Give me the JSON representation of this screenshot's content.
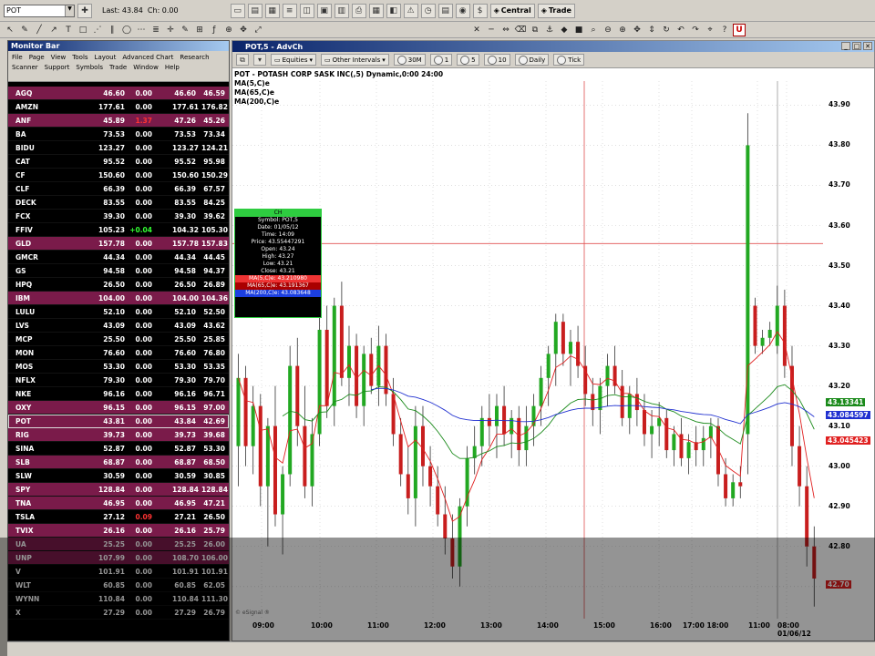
{
  "toolbar": {
    "symbol": "POT",
    "last_label": "Last: 43.84",
    "chg_label": "Ch: 0.00",
    "central_label": "Central",
    "trade_label": "Trade",
    "u_label": "U"
  },
  "monitor": {
    "title": "Monitor Bar",
    "menu": [
      "File",
      "Page",
      "View",
      "Tools",
      "Layout",
      "Advanced Chart",
      "Research",
      "Scanner",
      "Support",
      "Symbols",
      "Trade",
      "Window",
      "Help"
    ],
    "rows": [
      {
        "sym": "AGQ",
        "v1": "46.60",
        "v2": "0.00",
        "v3": "46.60",
        "v4": "46.59",
        "hl": true
      },
      {
        "sym": "AMZN",
        "v1": "177.61",
        "v2": "0.00",
        "v3": "177.61",
        "v4": "176.82",
        "hl": false
      },
      {
        "sym": "ANF",
        "v1": "45.89",
        "v2": "1.37",
        "v3": "47.26",
        "v4": "45.26",
        "hl": true
      },
      {
        "sym": "BA",
        "v1": "73.53",
        "v2": "0.00",
        "v3": "73.53",
        "v4": "73.34",
        "hl": false
      },
      {
        "sym": "BIDU",
        "v1": "123.27",
        "v2": "0.00",
        "v3": "123.27",
        "v4": "124.21",
        "hl": false
      },
      {
        "sym": "CAT",
        "v1": "95.52",
        "v2": "0.00",
        "v3": "95.52",
        "v4": "95.98",
        "hl": false
      },
      {
        "sym": "CF",
        "v1": "150.60",
        "v2": "0.00",
        "v3": "150.60",
        "v4": "150.29",
        "hl": false
      },
      {
        "sym": "CLF",
        "v1": "66.39",
        "v2": "0.00",
        "v3": "66.39",
        "v4": "67.57",
        "hl": false
      },
      {
        "sym": "DECK",
        "v1": "83.55",
        "v2": "0.00",
        "v3": "83.55",
        "v4": "84.25",
        "hl": false
      },
      {
        "sym": "FCX",
        "v1": "39.30",
        "v2": "0.00",
        "v3": "39.30",
        "v4": "39.62",
        "hl": false
      },
      {
        "sym": "FFIV",
        "v1": "105.23",
        "v2": "+0.04",
        "v3": "104.32",
        "v4": "105.30",
        "hl": false
      },
      {
        "sym": "GLD",
        "v1": "157.78",
        "v2": "0.00",
        "v3": "157.78",
        "v4": "157.83",
        "hl": true
      },
      {
        "sym": "GMCR",
        "v1": "44.34",
        "v2": "0.00",
        "v3": "44.34",
        "v4": "44.45",
        "hl": false
      },
      {
        "sym": "GS",
        "v1": "94.58",
        "v2": "0.00",
        "v3": "94.58",
        "v4": "94.37",
        "hl": false
      },
      {
        "sym": "HPQ",
        "v1": "26.50",
        "v2": "0.00",
        "v3": "26.50",
        "v4": "26.89",
        "hl": false
      },
      {
        "sym": "IBM",
        "v1": "104.00",
        "v2": "0.00",
        "v3": "104.00",
        "v4": "104.36",
        "hl": true
      },
      {
        "sym": "LULU",
        "v1": "52.10",
        "v2": "0.00",
        "v3": "52.10",
        "v4": "52.50",
        "hl": false
      },
      {
        "sym": "LVS",
        "v1": "43.09",
        "v2": "0.00",
        "v3": "43.09",
        "v4": "43.62",
        "hl": false
      },
      {
        "sym": "MCP",
        "v1": "25.50",
        "v2": "0.00",
        "v3": "25.50",
        "v4": "25.85",
        "hl": false
      },
      {
        "sym": "MON",
        "v1": "76.60",
        "v2": "0.00",
        "v3": "76.60",
        "v4": "76.80",
        "hl": false
      },
      {
        "sym": "MOS",
        "v1": "53.30",
        "v2": "0.00",
        "v3": "53.30",
        "v4": "53.35",
        "hl": false
      },
      {
        "sym": "NFLX",
        "v1": "79.30",
        "v2": "0.00",
        "v3": "79.30",
        "v4": "79.70",
        "hl": false
      },
      {
        "sym": "NKE",
        "v1": "96.16",
        "v2": "0.00",
        "v3": "96.16",
        "v4": "96.71",
        "hl": false
      },
      {
        "sym": "OXY",
        "v1": "96.15",
        "v2": "0.00",
        "v3": "96.15",
        "v4": "97.00",
        "hl": true
      },
      {
        "sym": "POT",
        "v1": "43.81",
        "v2": "0.00",
        "v3": "43.84",
        "v4": "42.69",
        "hl": true,
        "sel": true
      },
      {
        "sym": "RIG",
        "v1": "39.73",
        "v2": "0.00",
        "v3": "39.73",
        "v4": "39.68",
        "hl": true
      },
      {
        "sym": "SINA",
        "v1": "52.87",
        "v2": "0.00",
        "v3": "52.87",
        "v4": "53.30",
        "hl": false
      },
      {
        "sym": "SLB",
        "v1": "68.87",
        "v2": "0.00",
        "v3": "68.87",
        "v4": "68.50",
        "hl": true
      },
      {
        "sym": "SLW",
        "v1": "30.59",
        "v2": "0.00",
        "v3": "30.59",
        "v4": "30.85",
        "hl": false
      },
      {
        "sym": "SPY",
        "v1": "128.84",
        "v2": "0.00",
        "v3": "128.84",
        "v4": "128.84",
        "hl": true
      },
      {
        "sym": "TNA",
        "v1": "46.95",
        "v2": "0.00",
        "v3": "46.95",
        "v4": "47.21",
        "hl": true
      },
      {
        "sym": "TSLA",
        "v1": "27.12",
        "v2": "0.09",
        "v3": "27.21",
        "v4": "26.50",
        "hl": false
      },
      {
        "sym": "TVIX",
        "v1": "26.16",
        "v2": "0.00",
        "v3": "26.16",
        "v4": "25.79",
        "hl": true
      },
      {
        "sym": "UA",
        "v1": "25.25",
        "v2": "0.00",
        "v3": "25.25",
        "v4": "26.00",
        "hl": true
      },
      {
        "sym": "UNP",
        "v1": "107.99",
        "v2": "0.00",
        "v3": "108.70",
        "v4": "106.00",
        "hl": true
      },
      {
        "sym": "V",
        "v1": "101.91",
        "v2": "0.00",
        "v3": "101.91",
        "v4": "101.91",
        "hl": false
      },
      {
        "sym": "WLT",
        "v1": "60.85",
        "v2": "0.00",
        "v3": "60.85",
        "v4": "62.05",
        "hl": false
      },
      {
        "sym": "WYNN",
        "v1": "110.84",
        "v2": "0.00",
        "v3": "110.84",
        "v4": "111.30",
        "hl": false
      },
      {
        "sym": "X",
        "v1": "27.29",
        "v2": "0.00",
        "v3": "27.29",
        "v4": "26.79",
        "hl": false
      }
    ]
  },
  "chart_window": {
    "title": "POT,5 - AdvCh",
    "toolbar": {
      "equities": "Equities",
      "intervals": "Other Intervals",
      "i1": "30M",
      "i2": "1",
      "i3": "5",
      "i4": "10",
      "i5": "Daily",
      "i6": "Tick"
    },
    "info_line": "POT - POTASH CORP SASK INC(,5) Dynamic,0:00 24:00",
    "legends": [
      "MA(5,C)e",
      "MA(65,C)e",
      "MA(200,C)e"
    ],
    "legend_colors": [
      "#e02020",
      "#1a8a1a",
      "#2030d0"
    ],
    "data_box": {
      "header": "CH",
      "lines": [
        "Symbol: POT,5",
        "Date: 01/05/12",
        "Time: 14:09",
        "Price: 43.55447291",
        "Open: 43.24",
        "High: 43.27",
        "Low: 43.21",
        "Close: 43.21"
      ],
      "ma_lines": [
        "MA(5,C)e: 43.210980",
        "MA(65,C)e: 43.191367",
        "MA(200,C)e: 43.083648"
      ]
    },
    "right_tags": [
      "43.13341",
      "43.084597",
      "43.045423",
      "42.70"
    ],
    "footer_note": "© eSignal ®"
  },
  "chart_data": {
    "type": "candlestick",
    "yticks": [
      "43.90",
      "43.80",
      "43.70",
      "43.60",
      "43.50",
      "43.40",
      "43.30",
      "43.20",
      "43.10",
      "43.00",
      "42.90",
      "42.80",
      "42.70"
    ],
    "xticks": [
      "09:00",
      "10:00",
      "11:00",
      "12:00",
      "13:00",
      "14:00",
      "15:00",
      "16:00",
      "17:00 18:00",
      "11:00",
      "08:00 01/06/12"
    ],
    "ylim": [
      42.62,
      43.96
    ],
    "series": [
      {
        "name": "MA(5,C)e",
        "color": "#e02020"
      },
      {
        "name": "MA(65,C)e",
        "color": "#1a8a1a"
      },
      {
        "name": "MA(200,C)e",
        "color": "#2030d0"
      }
    ],
    "candles": [
      [
        43.05,
        43.28,
        42.95,
        43.22
      ],
      [
        43.22,
        43.25,
        43.0,
        43.05
      ],
      [
        43.05,
        43.2,
        42.98,
        43.15
      ],
      [
        43.15,
        43.18,
        42.9,
        42.95
      ],
      [
        42.95,
        43.12,
        42.8,
        43.1
      ],
      [
        43.1,
        43.2,
        42.85,
        42.88
      ],
      [
        42.88,
        43.0,
        42.78,
        42.98
      ],
      [
        42.98,
        43.3,
        42.95,
        43.25
      ],
      [
        43.25,
        43.32,
        43.05,
        43.1
      ],
      [
        43.1,
        43.2,
        42.92,
        42.95
      ],
      [
        42.95,
        43.12,
        42.9,
        43.08
      ],
      [
        43.08,
        43.38,
        43.05,
        43.34
      ],
      [
        43.34,
        43.4,
        43.12,
        43.15
      ],
      [
        43.15,
        43.42,
        43.1,
        43.4
      ],
      [
        43.4,
        43.46,
        43.2,
        43.22
      ],
      [
        43.22,
        43.35,
        43.15,
        43.3
      ],
      [
        43.3,
        43.33,
        43.12,
        43.15
      ],
      [
        43.15,
        43.3,
        43.1,
        43.28
      ],
      [
        43.28,
        43.32,
        43.18,
        43.2
      ],
      [
        43.2,
        43.35,
        43.15,
        43.3
      ],
      [
        43.3,
        43.33,
        43.15,
        43.18
      ],
      [
        43.18,
        43.22,
        43.05,
        43.08
      ],
      [
        43.08,
        43.12,
        42.95,
        42.98
      ],
      [
        42.98,
        43.05,
        42.88,
        42.92
      ],
      [
        42.92,
        43.15,
        42.85,
        43.1
      ],
      [
        43.1,
        43.15,
        42.95,
        43.0
      ],
      [
        43.0,
        43.05,
        42.9,
        42.95
      ],
      [
        42.95,
        43.0,
        42.85,
        42.88
      ],
      [
        42.88,
        42.95,
        42.78,
        42.82
      ],
      [
        42.82,
        42.88,
        42.72,
        42.75
      ],
      [
        42.75,
        42.92,
        42.7,
        42.9
      ],
      [
        42.9,
        43.05,
        42.85,
        43.02
      ],
      [
        43.02,
        43.1,
        42.98,
        43.05
      ],
      [
        43.05,
        43.15,
        43.0,
        43.12
      ],
      [
        43.12,
        43.18,
        43.05,
        43.1
      ],
      [
        43.1,
        43.18,
        43.02,
        43.15
      ],
      [
        43.15,
        43.2,
        43.05,
        43.08
      ],
      [
        43.08,
        43.14,
        43.02,
        43.12
      ],
      [
        43.12,
        43.15,
        43.0,
        43.04
      ],
      [
        43.04,
        43.15,
        43.0,
        43.1
      ],
      [
        43.1,
        43.18,
        43.05,
        43.15
      ],
      [
        43.15,
        43.25,
        43.1,
        43.22
      ],
      [
        43.22,
        43.3,
        43.15,
        43.28
      ],
      [
        43.28,
        43.38,
        43.2,
        43.36
      ],
      [
        43.36,
        43.38,
        43.25,
        43.28
      ],
      [
        43.28,
        43.34,
        43.2,
        43.31
      ],
      [
        43.31,
        43.35,
        43.22,
        43.25
      ],
      [
        43.25,
        43.3,
        43.15,
        43.18
      ],
      [
        43.18,
        43.22,
        43.1,
        43.14
      ],
      [
        43.14,
        43.22,
        43.08,
        43.2
      ],
      [
        43.2,
        43.28,
        43.15,
        43.25
      ],
      [
        43.25,
        43.3,
        43.18,
        43.2
      ],
      [
        43.2,
        43.24,
        43.1,
        43.12
      ],
      [
        43.12,
        43.2,
        43.08,
        43.18
      ],
      [
        43.18,
        43.22,
        43.1,
        43.14
      ],
      [
        43.14,
        43.18,
        43.05,
        43.08
      ],
      [
        43.08,
        43.14,
        43.02,
        43.1
      ],
      [
        43.1,
        43.16,
        43.05,
        43.12
      ],
      [
        43.12,
        43.14,
        43.02,
        43.04
      ],
      [
        43.04,
        43.1,
        43.0,
        43.08
      ],
      [
        43.08,
        43.12,
        43.0,
        43.02
      ],
      [
        43.02,
        43.08,
        42.98,
        43.06
      ],
      [
        43.06,
        43.1,
        43.0,
        43.04
      ],
      [
        43.04,
        43.1,
        43.0,
        43.07
      ],
      [
        43.07,
        43.12,
        43.02,
        43.1
      ],
      [
        43.1,
        43.12,
        42.95,
        42.98
      ],
      [
        42.98,
        43.02,
        42.9,
        42.92
      ],
      [
        42.92,
        42.98,
        42.9,
        42.96
      ],
      [
        42.96,
        43.0,
        42.92,
        42.95
      ],
      [
        43.08,
        43.88,
        42.98,
        43.8
      ],
      [
        43.4,
        43.42,
        43.28,
        43.3
      ],
      [
        43.3,
        43.34,
        43.28,
        43.32
      ],
      [
        43.32,
        43.36,
        43.3,
        43.34
      ],
      [
        43.3,
        43.45,
        43.28,
        43.4
      ],
      [
        43.4,
        43.44,
        43.22,
        43.25
      ],
      [
        43.25,
        43.3,
        43.0,
        43.05
      ],
      [
        43.05,
        43.1,
        42.9,
        42.95
      ],
      [
        42.95,
        43.0,
        42.75,
        42.8
      ],
      [
        42.8,
        42.85,
        42.65,
        42.72
      ]
    ]
  }
}
